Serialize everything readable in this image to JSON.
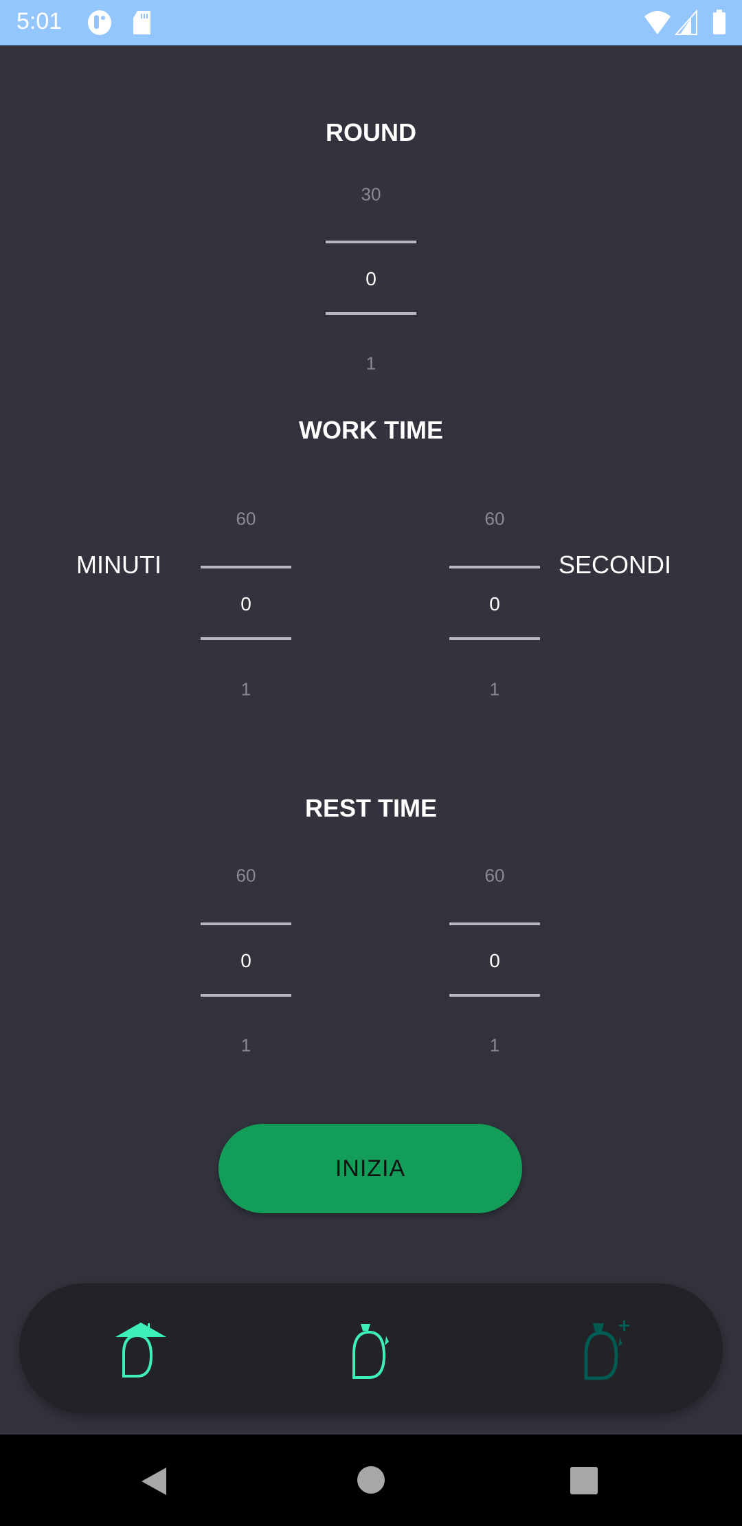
{
  "status_bar": {
    "time": "5:01",
    "color": "#94c6fe"
  },
  "round": {
    "title": "ROUND",
    "prev": "30",
    "value": "0",
    "next": "1"
  },
  "work_time": {
    "title": "WORK TIME",
    "minutes_label": "MINUTI",
    "seconds_label": "SECONDI",
    "minutes": {
      "prev": "60",
      "value": "0",
      "next": "1"
    },
    "seconds": {
      "prev": "60",
      "value": "0",
      "next": "1"
    }
  },
  "rest_time": {
    "title": "REST TIME",
    "minutes": {
      "prev": "60",
      "value": "0",
      "next": "1"
    },
    "seconds": {
      "prev": "60",
      "value": "0",
      "next": "1"
    }
  },
  "start_button": {
    "label": "INIZIA",
    "color": "#129e58"
  },
  "bottom_nav": {
    "items": [
      {
        "icon": "home-timer-icon",
        "active": true
      },
      {
        "icon": "stopwatch-icon",
        "active": true
      },
      {
        "icon": "stopwatch-add-icon",
        "active": false
      }
    ],
    "accent": "#3ef0b8",
    "inactive": "#005c52"
  }
}
